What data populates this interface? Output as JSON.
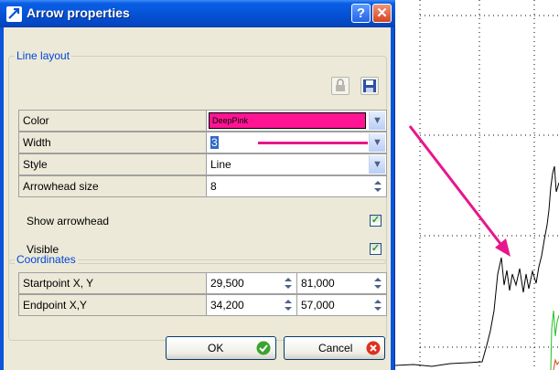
{
  "window": {
    "title": "Arrow properties"
  },
  "line_layout": {
    "legend": "Line layout",
    "rows": [
      {
        "label": "Color",
        "value": "DeepPink"
      },
      {
        "label": "Width",
        "value": "3"
      },
      {
        "label": "Style",
        "value": "Line"
      },
      {
        "label": "Arrowhead size",
        "value": "8"
      }
    ],
    "show_arrowhead": {
      "label": "Show arrowhead",
      "checked": true
    },
    "visible": {
      "label": "Visible",
      "checked": true
    },
    "color_swatch": "#ff1493"
  },
  "coordinates": {
    "legend": "Coordinates",
    "rows": [
      {
        "label": "Startpoint X, Y",
        "x": "29,500",
        "y": "81,000"
      },
      {
        "label": "Endpoint X,Y",
        "x": "34,200",
        "y": "57,000"
      }
    ]
  },
  "buttons": {
    "ok": "OK",
    "cancel": "Cancel"
  },
  "colors": {
    "arrow": "#e8168c",
    "titlebar": "#0553d6",
    "checkmark": "#21a121"
  },
  "icons": [
    "arrow-properties-app-icon",
    "help-icon",
    "close-icon",
    "lock-icon",
    "save-icon",
    "ok-check-icon",
    "cancel-x-icon",
    "chevron-down-icon",
    "spinner-icon",
    "checkbox-check-icon"
  ]
}
